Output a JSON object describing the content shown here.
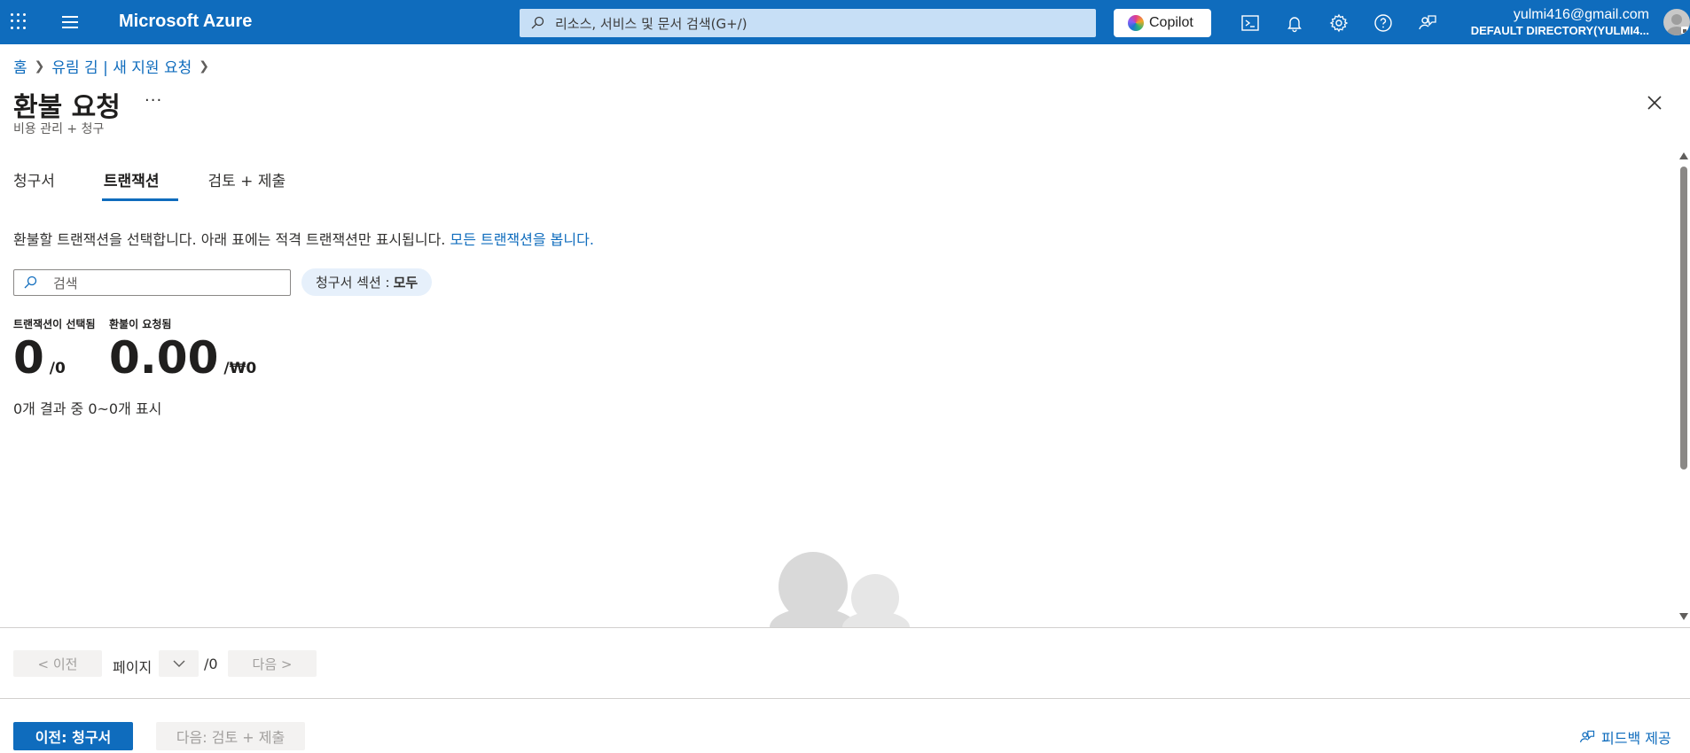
{
  "topbar": {
    "brand": "Microsoft Azure",
    "search_placeholder": "리소스, 서비스 및 문서 검색(G+/)",
    "copilot_label": "Copilot",
    "account_email": "yulmi416@gmail.com",
    "account_directory": "DEFAULT DIRECTORY(YULMI4...",
    "icons": [
      "cloud-shell-icon",
      "bell-icon",
      "gear-icon",
      "help-icon",
      "feedback-icon"
    ],
    "color": "#0f6cbd"
  },
  "breadcrumb": {
    "home": "홈",
    "parent": "유림 김 | 새 지원 요청"
  },
  "page": {
    "title": "환불 요청",
    "more": "···",
    "subtitle": "비용 관리 + 청구"
  },
  "tabs": [
    {
      "label": "청구서"
    },
    {
      "label": "트랜잭션"
    },
    {
      "label": "검토 + 제출"
    }
  ],
  "active_tab": "트랜잭션",
  "description": {
    "text": "환불할 트랜잭션을 선택합니다. 아래 표에는 적격 트랜잭션만 표시됩니다.",
    "link": "모든 트랜잭션을 봅니다."
  },
  "filter": {
    "search_placeholder": "검색",
    "pill_label": "청구서 섹션 :",
    "pill_value": "모두"
  },
  "stats": {
    "selected_label": "트랜잭션이 선택됨",
    "selected_value": "0",
    "selected_total": "/0",
    "refund_label": "환불이 요청됨",
    "refund_value": "0.00",
    "refund_total": "/₩0"
  },
  "results_text": "0개 결과 중 0~0개 표시",
  "pager": {
    "prev": "< 이전",
    "page_label": "페이지",
    "total": "/0",
    "next": "다음 >"
  },
  "footer": {
    "prev_button": "이전: 청구서",
    "next_button": "다음: 검토 + 제출",
    "feedback": "피드백 제공"
  }
}
